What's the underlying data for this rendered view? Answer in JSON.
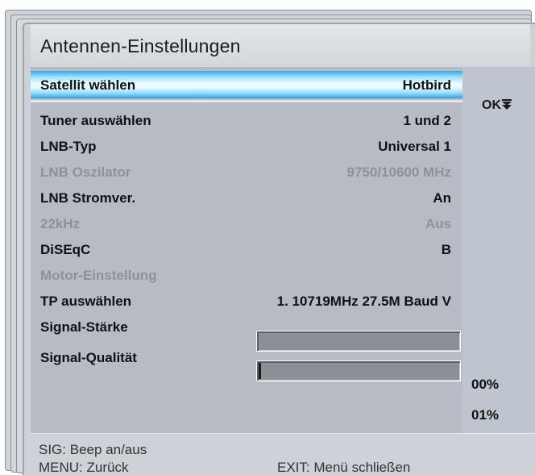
{
  "window": {
    "title": "Antennen-Einstellungen",
    "ok_label": "OK",
    "ok_icon": "arrow-down-double-icon"
  },
  "menu": {
    "selected": {
      "label": "Satellit wählen",
      "value": "Hotbird"
    },
    "rows": [
      {
        "label": "Tuner auswählen",
        "value": "1 und 2",
        "enabled": true
      },
      {
        "label": "LNB-Typ",
        "value": "Universal 1",
        "enabled": true
      },
      {
        "label": "LNB Oszilator",
        "value": "9750/10600 MHz",
        "enabled": false
      },
      {
        "label": "LNB Stromver.",
        "value": "An",
        "enabled": true
      },
      {
        "label": "22kHz",
        "value": "Aus",
        "enabled": false
      },
      {
        "label": "DiSEqC",
        "value": "B",
        "enabled": true
      },
      {
        "label": "Motor-Einstellung",
        "value": "",
        "enabled": false
      },
      {
        "label": "TP auswählen",
        "value": "1. 10719MHz 27.5M Baud V",
        "enabled": true
      }
    ],
    "signal_strength": {
      "label": "Signal-Stärke",
      "percent_text": "00%",
      "level": 0.0
    },
    "signal_quality": {
      "label": "Signal-Qualität",
      "percent_text": "01%",
      "level": 0.01
    }
  },
  "footer": {
    "sig_hint": "SIG: Beep an/aus",
    "menu_hint": "MENU: Zurück",
    "exit_hint": "EXIT: Menü schließen"
  },
  "colors": {
    "highlight": "#2fa9e6",
    "menu_bg": "#b7bcc4",
    "disabled_text": "#8d9299"
  }
}
